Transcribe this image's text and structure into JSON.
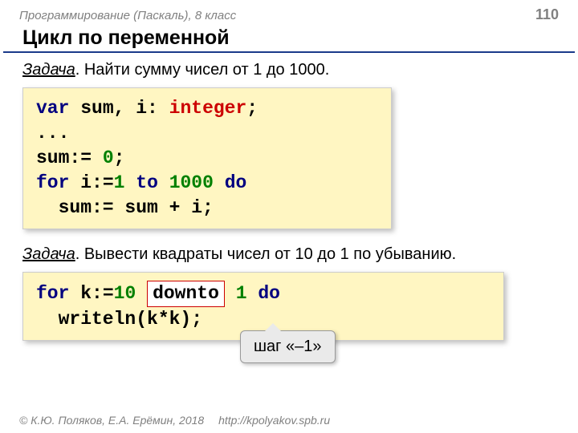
{
  "header": {
    "course": "Программирование (Паскаль), 8 класс",
    "page": "110"
  },
  "title": "Цикл по переменной",
  "task1": {
    "label": "Задача",
    "text": ". Найти сумму чисел от 1 до 1000."
  },
  "code1": {
    "l1a": "var",
    "l1b": " sum, i: ",
    "l1c": "integer",
    "l1d": ";",
    "l2": "...",
    "l3": "sum:= ",
    "l3n": "0",
    "l3e": ";",
    "l4a": "for",
    "l4b": " i:=",
    "l4n1": "1",
    "l4c": " ",
    "l4d": "to",
    "l4e": " ",
    "l4n2": "1000",
    "l4f": " ",
    "l4g": "do",
    "l5": "sum:= sum + i;"
  },
  "task2": {
    "label": "Задача",
    "text": ". Вывести квадраты чисел от 10 до 1 по убыванию."
  },
  "code2": {
    "l1a": "for",
    "l1b": " k:=",
    "l1n1": "10",
    "l1c": " ",
    "downto": "downto",
    "l1d": " ",
    "l1n2": "1",
    "l1e": " ",
    "l1f": "do",
    "l2": "writeln(k*k);"
  },
  "callout": "шаг «–1»",
  "footer": {
    "copy": "© К.Ю. Поляков, Е.А. Ерёмин, 2018",
    "url": "http://kpolyakov.spb.ru"
  }
}
